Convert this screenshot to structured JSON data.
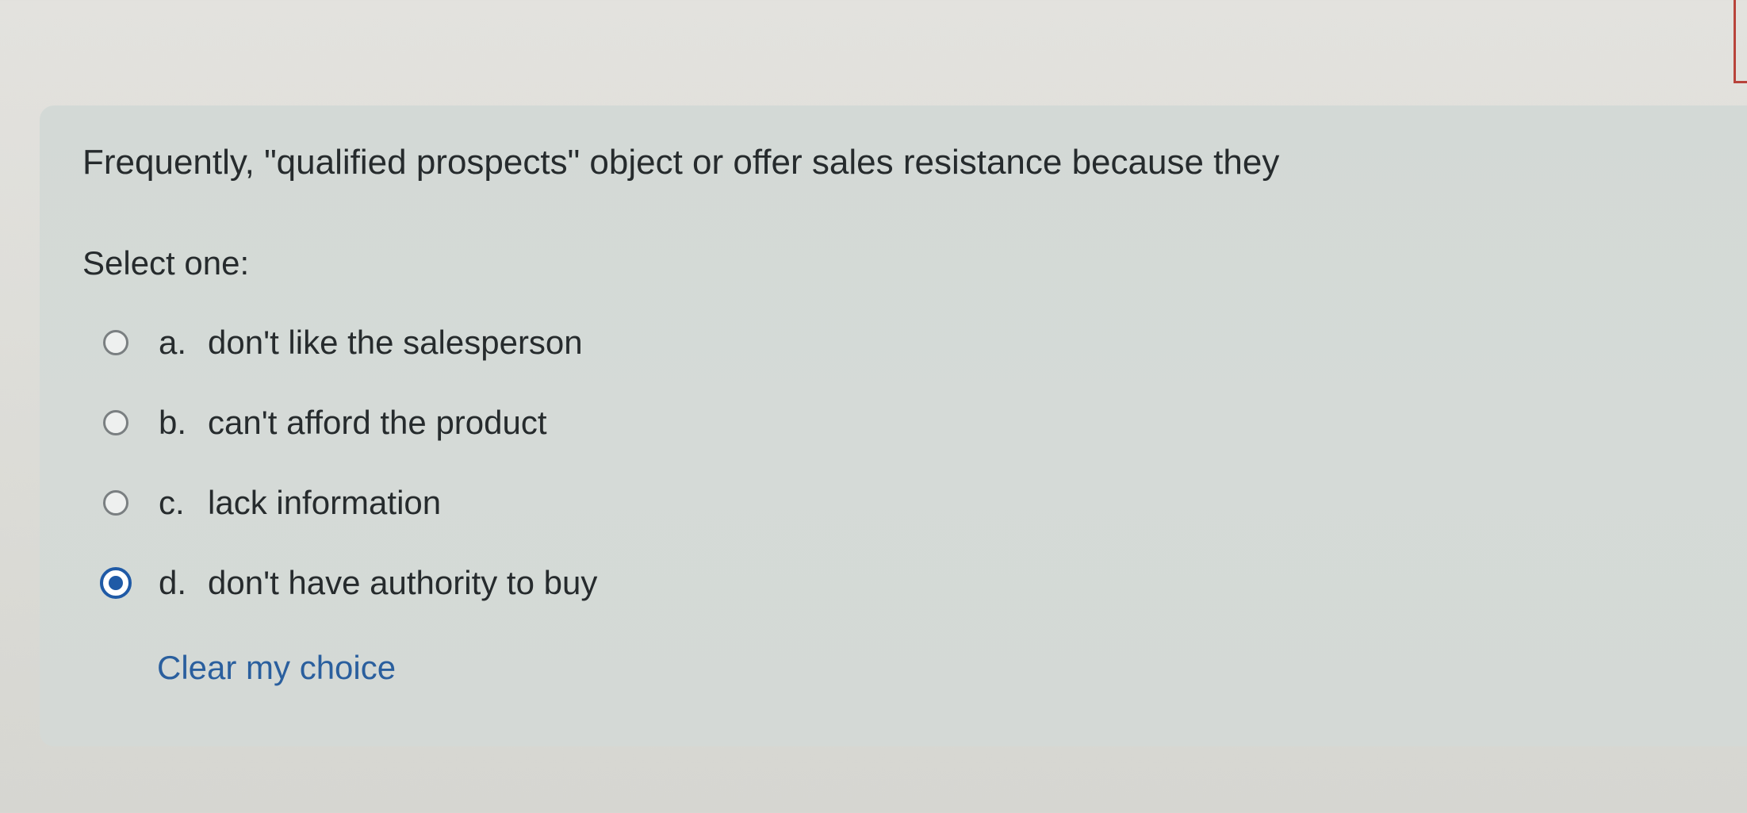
{
  "question": {
    "text": "Frequently, \"qualified prospects\" object or offer sales resistance because they",
    "prompt": "Select one:"
  },
  "options": [
    {
      "letter": "a.",
      "text": "don't like the salesperson",
      "selected": false
    },
    {
      "letter": "b.",
      "text": "can't afford the product",
      "selected": false
    },
    {
      "letter": "c.",
      "text": "lack information",
      "selected": false
    },
    {
      "letter": "d.",
      "text": "don't have authority to buy",
      "selected": true
    }
  ],
  "clear_choice_label": "Clear my choice",
  "colors": {
    "accent": "#1f5aa6",
    "link": "#2a5f9e",
    "card_background": "#d4d9d6",
    "page_background": "#deded9"
  }
}
